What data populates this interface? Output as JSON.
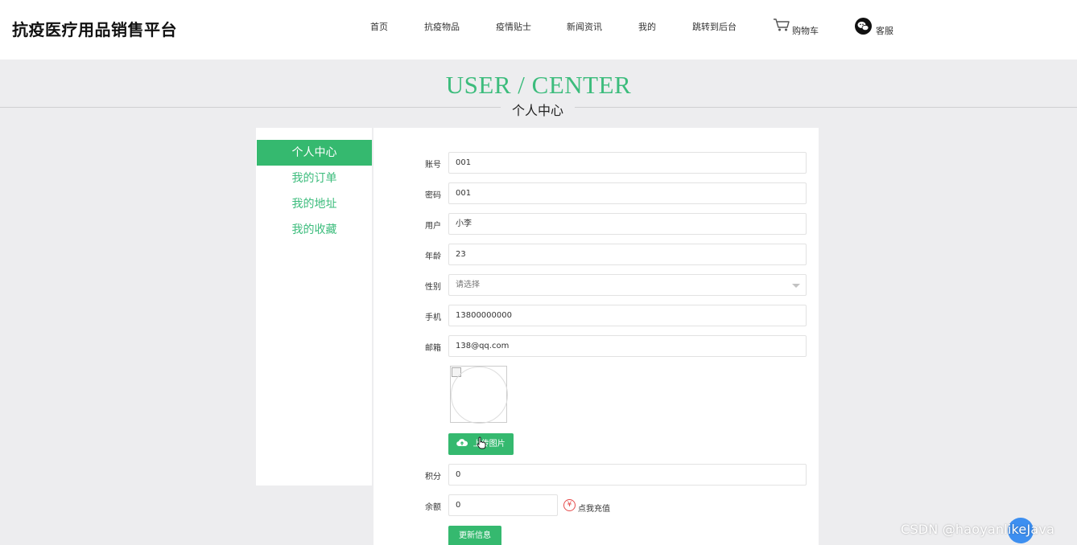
{
  "header": {
    "logo": "抗疫医疗用品销售平台",
    "nav": [
      "首页",
      "抗疫物品",
      "疫情贴士",
      "新闻资讯",
      "我的",
      "跳转到后台"
    ],
    "cart_label": "购物车",
    "service_label": "客服"
  },
  "banner": {
    "title": "USER / CENTER",
    "subtitle": "个人中心"
  },
  "sidebar": {
    "items": [
      {
        "label": "个人中心",
        "active": true
      },
      {
        "label": "我的订单",
        "active": false
      },
      {
        "label": "我的地址",
        "active": false
      },
      {
        "label": "我的收藏",
        "active": false
      }
    ]
  },
  "form": {
    "account": {
      "label": "账号",
      "value": "001"
    },
    "password": {
      "label": "密码",
      "value": "001"
    },
    "user": {
      "label": "用户",
      "value": "小李"
    },
    "age": {
      "label": "年龄",
      "value": "23"
    },
    "gender": {
      "label": "性别",
      "placeholder": "请选择"
    },
    "phone": {
      "label": "手机",
      "value": "13800000000"
    },
    "email": {
      "label": "邮箱",
      "value": "138@qq.com"
    },
    "upload_button": "上传图片",
    "points": {
      "label": "积分",
      "value": "0"
    },
    "balance": {
      "label": "余额",
      "value": "0"
    },
    "recharge_link": "点我充值",
    "submit_button": "更新信息"
  },
  "watermark": "CSDN @haoyanlikeJava",
  "colors": {
    "accent": "#35b96f",
    "title": "#3cbc7c",
    "background": "#ededef"
  }
}
